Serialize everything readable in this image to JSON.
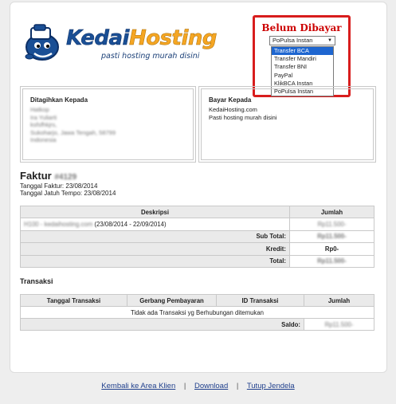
{
  "brand": {
    "name_part1": "Kedai",
    "name_part2": "Hosting",
    "tagline": "pasti hosting murah disini"
  },
  "status": {
    "title": "Belum Dibayar",
    "selected": "PoPulsa Instan",
    "options": [
      "Transfer BCA",
      "Transfer Mandiri",
      "Transfer BNI",
      "PayPal",
      "KlikBCA Instan",
      "PoPulsa Instan"
    ],
    "highlighted_index": 0
  },
  "billed_to": {
    "heading": "Ditagihkan Kepada",
    "lines": [
      "Hatkop",
      "Ira Yuliarti",
      "ksfsfhkjrs,",
      "Sukoharjo, Jawa Tengah, 58799",
      "Indonesia"
    ]
  },
  "pay_to": {
    "heading": "Bayar Kepada",
    "lines": [
      "KedaiHosting.com",
      "Pasti hosting murah disini"
    ]
  },
  "invoice": {
    "title": "Faktur",
    "number": "#4129",
    "date": "Tanggal Faktur: 23/08/2014",
    "due": "Tanggal Jatuh Tempo: 23/08/2014"
  },
  "items_table": {
    "headers": [
      "Deskripsi",
      "Jumlah"
    ],
    "row_desc_blur": "H100 - kedaihosting.com",
    "row_desc_period": "(23/08/2014 - 22/09/2014)",
    "row_amount": "Rp11.500-",
    "subtotal_label": "Sub Total:",
    "subtotal_value": "Rp11.500-",
    "credit_label": "Kredit:",
    "credit_value": "Rp0-",
    "total_label": "Total:",
    "total_value": "Rp11.500-"
  },
  "transactions": {
    "heading": "Transaksi",
    "headers": [
      "Tanggal Transaksi",
      "Gerbang Pembayaran",
      "ID Transaksi",
      "Jumlah"
    ],
    "empty_text": "Tidak ada Transaksi yg Berhubungan ditemukan",
    "balance_label": "Saldo:",
    "balance_value": "Rp11.500-"
  },
  "footer": {
    "back_link": "Kembali ke Area Klien",
    "download_link": "Download",
    "close_link": "Tutup Jendela",
    "separator": "|"
  },
  "colors": {
    "accent_red": "#d81d1d",
    "brand_blue": "#1a4f95",
    "brand_orange": "#f5a623",
    "highlight": "#1e66d0"
  }
}
